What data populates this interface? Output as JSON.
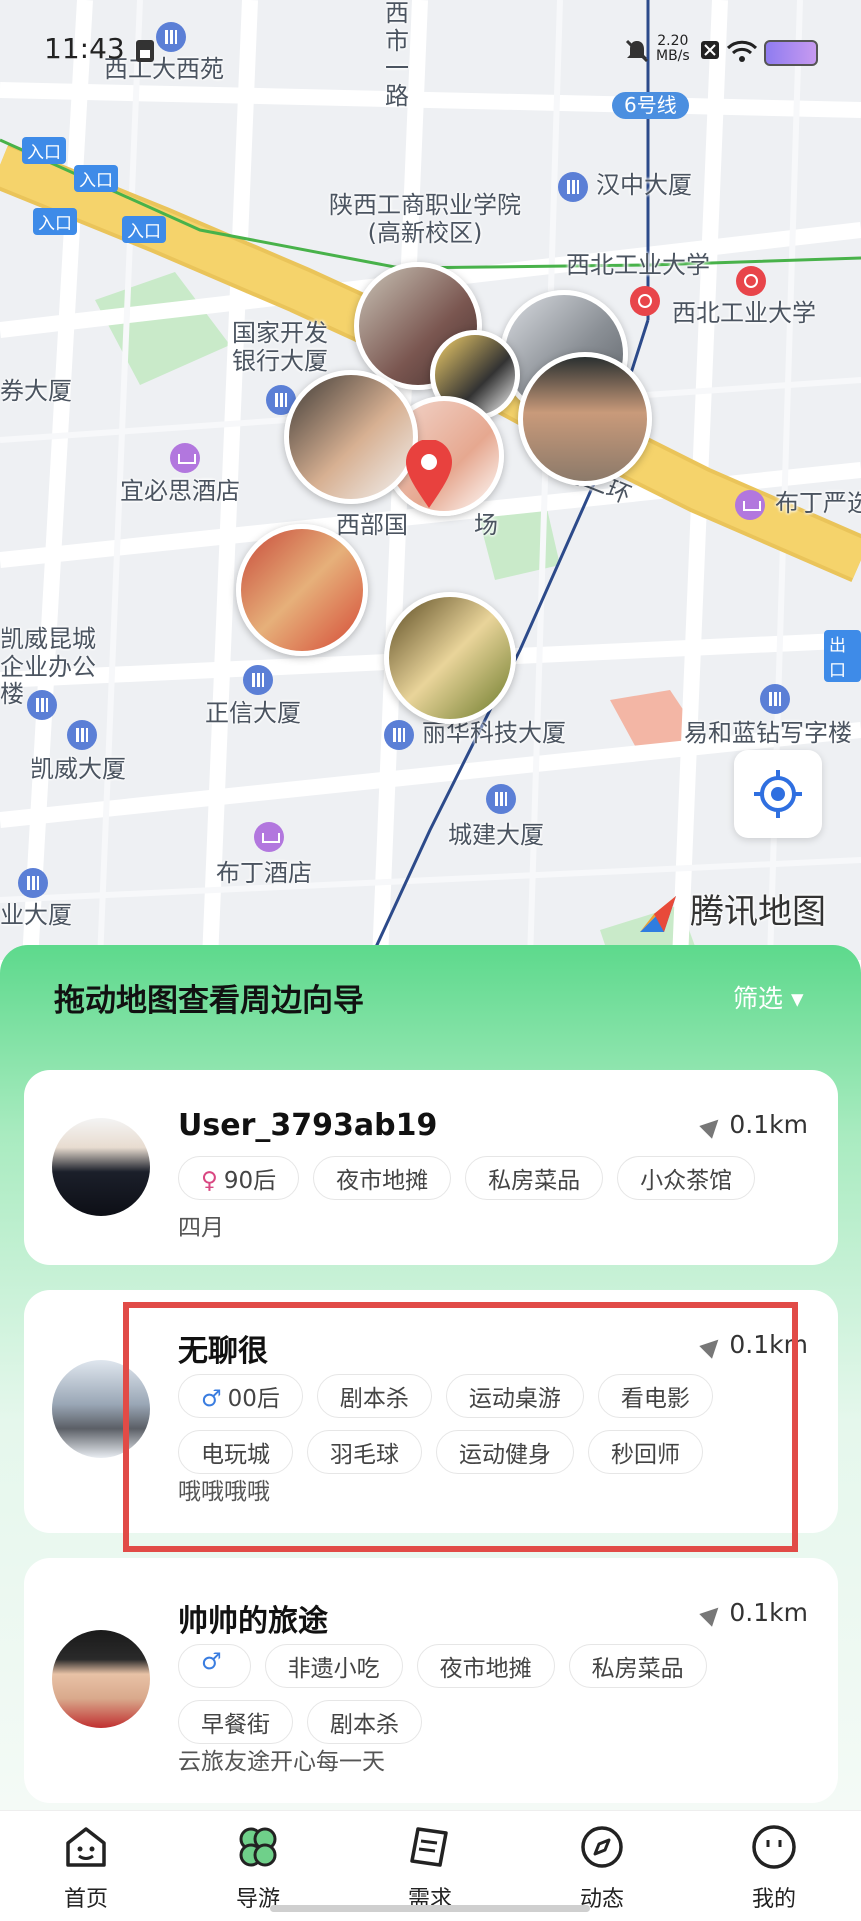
{
  "status_bar": {
    "time": "11:43",
    "net_speed": "2.20",
    "net_unit": "MB/s"
  },
  "map": {
    "pois": [
      "西工大西苑",
      "西市一路",
      "6号线",
      "入口",
      "入口",
      "入口",
      "入口",
      "汉中大厦",
      "陕西工商职业学院(高新校区)",
      "西北工业大学",
      "西北工业大学",
      "国家开发银行大厦",
      "券大厦",
      "宜必思酒店",
      "西部国",
      "场",
      "南二环",
      "布丁严选",
      "凯威昆城企业办公楼",
      "正信大厦",
      "凯威大厦",
      "丽华科技大厦",
      "易和蓝钻写字楼",
      "出口",
      "城建大厦",
      "布丁酒店",
      "业大厦",
      "腾讯地图"
    ]
  },
  "panel": {
    "title": "拖动地图查看周边向导",
    "filter_label": "筛选 ▾",
    "cards": [
      {
        "name": "User_3793ab19",
        "distance": "0.1km",
        "gender": "female",
        "gender_symbol": "♀",
        "tags": [
          "90后",
          "夜市地摊",
          "私房菜品",
          "小众茶馆"
        ],
        "bio": "四月"
      },
      {
        "name": "无聊很",
        "distance": "0.1km",
        "gender": "male",
        "gender_symbol": "♂",
        "tags": [
          "00后",
          "剧本杀",
          "运动桌游",
          "看电影",
          "电玩城",
          "羽毛球",
          "运动健身",
          "秒回师"
        ],
        "bio": "哦哦哦哦"
      },
      {
        "name": "帅帅的旅途",
        "distance": "0.1km",
        "gender": "male",
        "gender_symbol": "♂",
        "tags": [
          "",
          "非遗小吃",
          "夜市地摊",
          "私房菜品",
          "早餐街",
          "剧本杀"
        ],
        "bio": "云旅友途开心每一天"
      }
    ]
  },
  "tabbar": {
    "tabs": [
      {
        "label": "首页",
        "icon": "home-face-icon"
      },
      {
        "label": "导游",
        "icon": "guide-icon"
      },
      {
        "label": "需求",
        "icon": "request-note-icon"
      },
      {
        "label": "动态",
        "icon": "compass-icon"
      },
      {
        "label": "我的",
        "icon": "profile-face-icon"
      }
    ]
  },
  "colors": {
    "accent_green": "#5dd98c",
    "highlight_red": "#e14b47",
    "map_road_yellow": "#f5d36b"
  }
}
